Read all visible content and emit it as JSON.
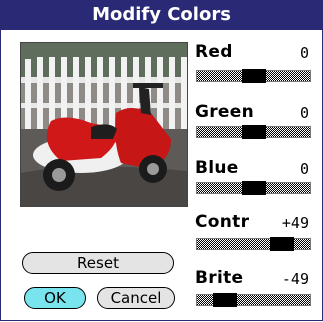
{
  "dialog": {
    "title": "Modify Colors"
  },
  "photo": {
    "subject": "scooter-photo"
  },
  "buttons": {
    "reset": "Reset",
    "ok": "OK",
    "cancel": "Cancel"
  },
  "adjustments": [
    {
      "label": "Red",
      "value": "0",
      "level": 0.5
    },
    {
      "label": "Green",
      "value": "0",
      "level": 0.5
    },
    {
      "label": "Blue",
      "value": "0",
      "level": 0.5
    },
    {
      "label": "Contr",
      "value": "+49",
      "level": 0.75
    },
    {
      "label": "Brite",
      "value": "-49",
      "level": 0.25
    }
  ],
  "colors": {
    "title_bar": "#2a2975",
    "selected_button": "#79e3ee"
  }
}
